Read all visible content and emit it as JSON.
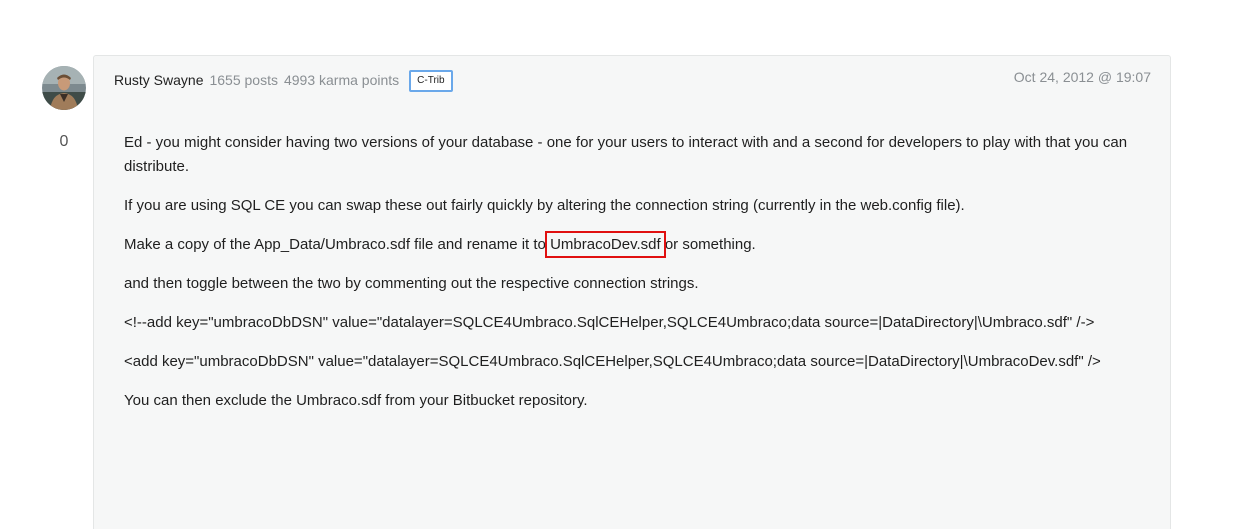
{
  "post": {
    "author": "Rusty Swayne",
    "posts": "1655 posts",
    "karma": "4993 karma points",
    "badge": "C-Trib",
    "date": "Oct 24, 2012 @ 19:07",
    "votes": "0"
  },
  "content": {
    "p1": "Ed - you might consider having two versions of your database - one for your users to interact with and a second for developers to play with that you can distribute.",
    "p2": "If you are using SQL CE you can swap these out fairly quickly by altering the connection string (currently in the web.config file).",
    "p3_before": "Make a copy of the App_Data/Umbraco.sdf file and rename it to ",
    "p3_highlight": "UmbracoDev.sdf",
    "p3_after": " or something.",
    "p4": "and then toggle between the two by commenting out the respective connection strings.",
    "p5": "<!--add key=\"umbracoDbDSN\" value=\"datalayer=SQLCE4Umbraco.SqlCEHelper,SQLCE4Umbraco;data source=|DataDirectory|\\Umbraco.sdf\" /->",
    "p6": "<add key=\"umbracoDbDSN\" value=\"datalayer=SQLCE4Umbraco.SqlCEHelper,SQLCE4Umbraco;data source=|DataDirectory|\\UmbracoDev.sdf\" />",
    "p7": "You can then exclude the Umbraco.sdf from your Bitbucket repository."
  },
  "colors": {
    "badge_border": "#6aa8ea",
    "highlight_box": "#e01010",
    "card_background": "#f6f7f7"
  }
}
